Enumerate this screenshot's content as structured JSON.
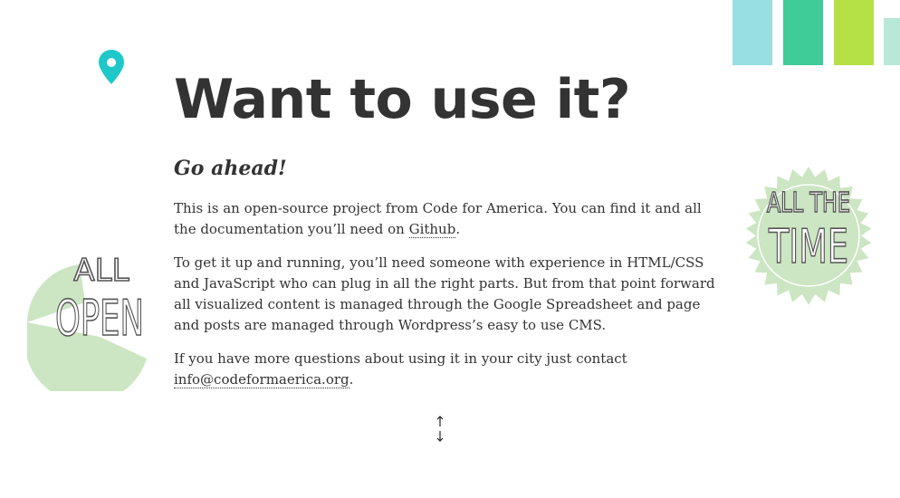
{
  "heading": "Want to use it?",
  "subheading": "Go ahead!",
  "paragraph1": {
    "text": "This is an open-source project from Code for America. You can find it and all the documentation you’ll need on ",
    "link": "Github",
    "end": "."
  },
  "paragraph2": "To get it up and running, you’ll need someone with experience in HTML/CSS and JavaScript who can plug in all the right parts. But from that point forward all visualized content is managed through the Google Spreadsheet and page and posts are managed through Wordpress’s easy to use CMS.",
  "paragraph3": {
    "text": "If you have more questions about using it in your city just contact ",
    "link": "info@codeformaerica.org",
    "end": "."
  },
  "badge_left": {
    "line1": "ALL",
    "line2": "OPEN"
  },
  "badge_right": {
    "line1": "ALL THE",
    "line2": "TIME"
  },
  "icons": {
    "pin": "map-pin-icon",
    "arrows": "up-down-arrows-icon"
  },
  "colors": {
    "pin": "#1ec8c8",
    "badge_fill": "#cce5c2",
    "bars": [
      "#97dfe0",
      "#3fcc98",
      "#b5e046",
      "#b8e8d8"
    ],
    "text": "#333333"
  }
}
